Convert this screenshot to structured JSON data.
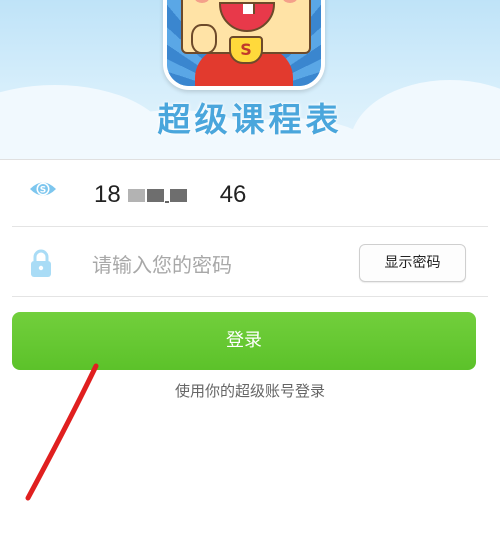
{
  "app": {
    "title": "超级课程表"
  },
  "login_form": {
    "phone_prefix": "18",
    "phone_suffix": "46",
    "password_placeholder": "请输入您的密码",
    "show_password_label": "显示密码",
    "login_button_label": "登录",
    "hint": "使用你的超级账号登录"
  },
  "colors": {
    "primary_green": "#5cc22a",
    "title_blue": "#4aa6dc",
    "annotation_red": "#e01f1f"
  },
  "icons": {
    "phone_row": "phone-badge-icon",
    "password_row": "lock-icon"
  }
}
